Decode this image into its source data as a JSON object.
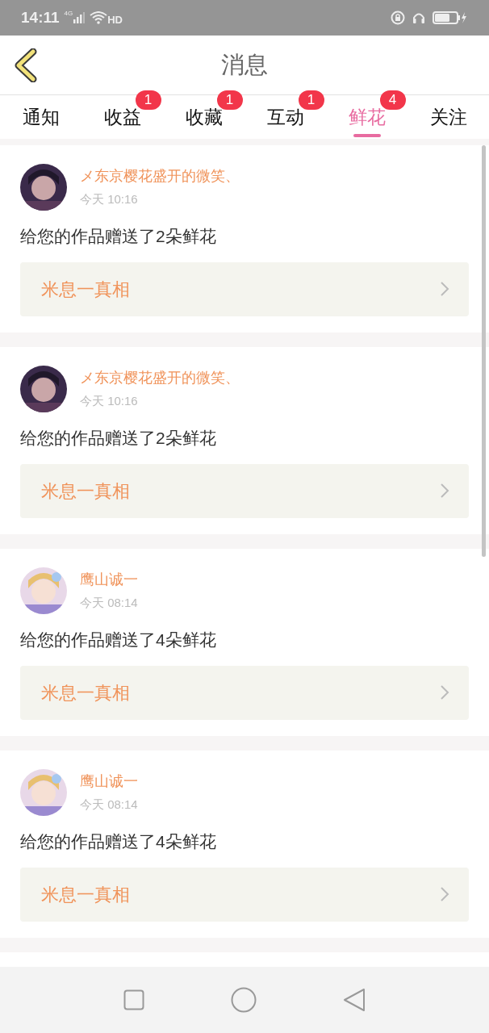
{
  "status_bar": {
    "time": "14:11",
    "network": "4G",
    "call": "HD"
  },
  "header": {
    "title": "消息"
  },
  "tabs": [
    {
      "label": "通知",
      "selected": false
    },
    {
      "label": "收益",
      "badge": "1",
      "selected": false
    },
    {
      "label": "收藏",
      "badge": "1",
      "selected": false
    },
    {
      "label": "互动",
      "badge": "1",
      "selected": false
    },
    {
      "label": "鲜花",
      "badge": "4",
      "selected": true
    },
    {
      "label": "关注",
      "selected": false
    }
  ],
  "messages": [
    {
      "sender": "メ东京樱花盛开的微笑、",
      "time": "今天 10:16",
      "text": "给您的作品赠送了2朵鲜花",
      "link": "米息一真相"
    },
    {
      "sender": "メ东京樱花盛开的微笑、",
      "time": "今天 10:16",
      "text": "给您的作品赠送了2朵鲜花",
      "link": "米息一真相"
    },
    {
      "sender": "鹰山诚一",
      "time": "今天 08:14",
      "text": "给您的作品赠送了4朵鲜花",
      "link": "米息一真相"
    },
    {
      "sender": "鹰山诚一",
      "time": "今天 08:14",
      "text": "给您的作品赠送了4朵鲜花",
      "link": "米息一真相"
    }
  ]
}
